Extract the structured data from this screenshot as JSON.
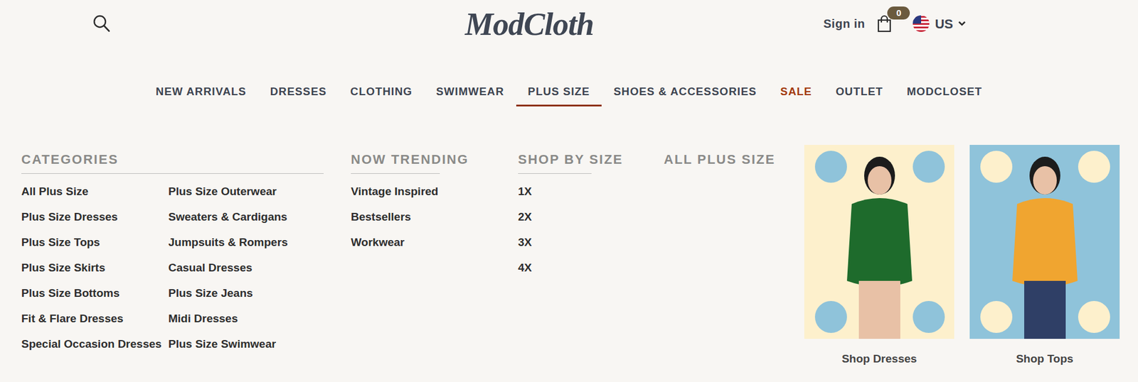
{
  "header": {
    "logo": "ModCloth",
    "sign_in": "Sign in",
    "cart_count": "0",
    "region": "US"
  },
  "nav": [
    {
      "label": "NEW ARRIVALS",
      "selected": false,
      "color": "#3d4450"
    },
    {
      "label": "DRESSES",
      "selected": false,
      "color": "#3d4450"
    },
    {
      "label": "CLOTHING",
      "selected": false,
      "color": "#3d4450"
    },
    {
      "label": "SWIMWEAR",
      "selected": false,
      "color": "#3d4450"
    },
    {
      "label": "PLUS SIZE",
      "selected": true,
      "color": "#3d4450"
    },
    {
      "label": "SHOES & ACCESSORIES",
      "selected": false,
      "color": "#3d4450"
    },
    {
      "label": "SALE",
      "selected": false,
      "color": "#a23a0f"
    },
    {
      "label": "OUTLET",
      "selected": false,
      "color": "#3d4450"
    },
    {
      "label": "MODCLOSET",
      "selected": false,
      "color": "#3d4450"
    }
  ],
  "menu": {
    "categories": {
      "title": "CATEGORIES",
      "items": [
        "All Plus Size",
        "Plus Size Dresses",
        "Plus Size Tops",
        "Plus Size Skirts",
        "Plus Size Bottoms",
        "Fit & Flare Dresses",
        "Special Occasion Dresses",
        "Plus Size Outerwear",
        "Sweaters & Cardigans",
        "Jumpsuits & Rompers",
        "Casual Dresses",
        "Plus Size Jeans",
        "Midi Dresses",
        "Plus Size Swimwear"
      ]
    },
    "now_trending": {
      "title": "NOW TRENDING",
      "items": [
        "Vintage Inspired",
        "Bestsellers",
        "Workwear"
      ]
    },
    "shop_by_size": {
      "title": "SHOP BY SIZE",
      "items": [
        "1X",
        "2X",
        "3X",
        "4X"
      ]
    },
    "all_plus_size": {
      "title": "ALL PLUS SIZE"
    },
    "promos": [
      {
        "caption": "Shop Dresses"
      },
      {
        "caption": "Shop Tops"
      }
    ]
  }
}
